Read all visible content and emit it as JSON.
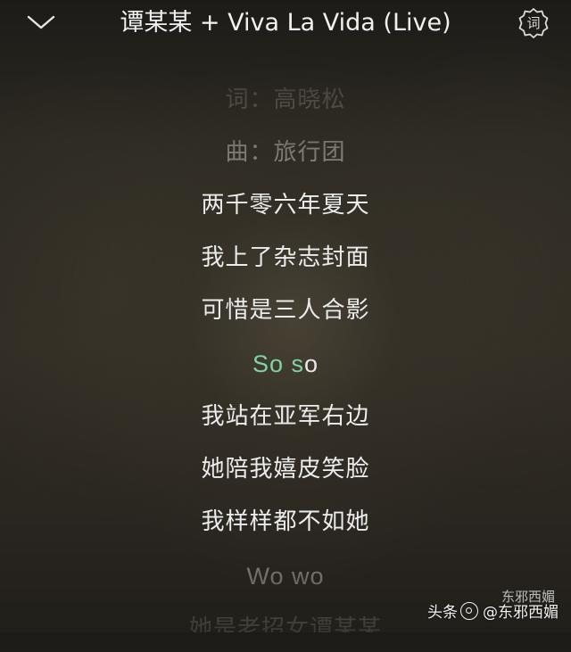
{
  "header": {
    "collapse_icon": "chevron-down-icon",
    "title": "谭某某 + Viva La Vida (Live)",
    "lyric_button_icon": "gear-icon",
    "lyric_button_glyph": "词"
  },
  "lyrics": {
    "active_color": "#7fd3a6",
    "lines": [
      {
        "text": "词：高晓松",
        "state": "faint"
      },
      {
        "text": "曲：旅行团",
        "state": "dim"
      },
      {
        "text": "两千零六年夏天",
        "state": "normal"
      },
      {
        "text": "我上了杂志封面",
        "state": "normal"
      },
      {
        "text": "可惜是三人合影",
        "state": "normal"
      },
      {
        "text": "So so",
        "state": "active",
        "sung_part": "So s",
        "remaining_part": "o"
      },
      {
        "text": "我站在亚军右边",
        "state": "normal"
      },
      {
        "text": "她陪我嬉皮笑脸",
        "state": "normal"
      },
      {
        "text": "我样样都不如她",
        "state": "normal"
      },
      {
        "text": "Wo wo",
        "state": "dim"
      },
      {
        "text": "她是老招女谭某某",
        "state": "faint"
      }
    ]
  },
  "watermark": {
    "platform": "头条",
    "account": "@东邪西媚",
    "overlay_text": "东邪西媚"
  }
}
